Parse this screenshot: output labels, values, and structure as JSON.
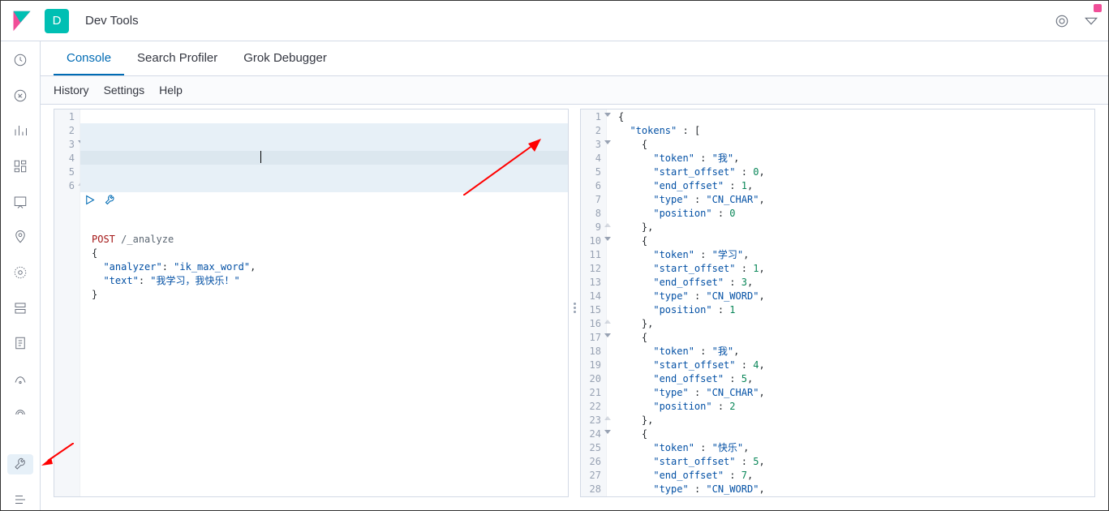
{
  "header": {
    "space_letter": "D",
    "breadcrumb": "Dev Tools"
  },
  "tabs": {
    "console": "Console",
    "profiler": "Search Profiler",
    "grok": "Grok Debugger"
  },
  "subbar": {
    "history": "History",
    "settings": "Settings",
    "help": "Help"
  },
  "request": {
    "lines": [
      "1",
      "2",
      "3",
      "4",
      "5",
      "6"
    ],
    "method": "POST",
    "url": "/_analyze",
    "body_open": "{",
    "analyzer_key": "\"analyzer\"",
    "analyzer_val": "\"ik_max_word\"",
    "text_key": "\"text\"",
    "text_val": "\"我学习，我快乐！\"",
    "body_close": "}"
  },
  "response": {
    "lines": [
      "1",
      "2",
      "3",
      "4",
      "5",
      "6",
      "7",
      "8",
      "9",
      "10",
      "11",
      "12",
      "13",
      "14",
      "15",
      "16",
      "17",
      "18",
      "19",
      "20",
      "21",
      "22",
      "23",
      "24",
      "25",
      "26",
      "27",
      "28"
    ],
    "rows": [
      {
        "indent": 0,
        "t": "punct",
        "v": "{"
      },
      {
        "indent": 1,
        "k": "\"tokens\"",
        "sep": " : ",
        "v": "[",
        "vt": "punct"
      },
      {
        "indent": 2,
        "t": "punct",
        "v": "{"
      },
      {
        "indent": 3,
        "k": "\"token\"",
        "sep": " : ",
        "v": "\"我\"",
        "vt": "str",
        "c": ","
      },
      {
        "indent": 3,
        "k": "\"start_offset\"",
        "sep": " : ",
        "v": "0",
        "vt": "num",
        "c": ","
      },
      {
        "indent": 3,
        "k": "\"end_offset\"",
        "sep": " : ",
        "v": "1",
        "vt": "num",
        "c": ","
      },
      {
        "indent": 3,
        "k": "\"type\"",
        "sep": " : ",
        "v": "\"CN_CHAR\"",
        "vt": "str",
        "c": ","
      },
      {
        "indent": 3,
        "k": "\"position\"",
        "sep": " : ",
        "v": "0",
        "vt": "num"
      },
      {
        "indent": 2,
        "t": "punct",
        "v": "},"
      },
      {
        "indent": 2,
        "t": "punct",
        "v": "{"
      },
      {
        "indent": 3,
        "k": "\"token\"",
        "sep": " : ",
        "v": "\"学习\"",
        "vt": "str",
        "c": ","
      },
      {
        "indent": 3,
        "k": "\"start_offset\"",
        "sep": " : ",
        "v": "1",
        "vt": "num",
        "c": ","
      },
      {
        "indent": 3,
        "k": "\"end_offset\"",
        "sep": " : ",
        "v": "3",
        "vt": "num",
        "c": ","
      },
      {
        "indent": 3,
        "k": "\"type\"",
        "sep": " : ",
        "v": "\"CN_WORD\"",
        "vt": "str",
        "c": ","
      },
      {
        "indent": 3,
        "k": "\"position\"",
        "sep": " : ",
        "v": "1",
        "vt": "num"
      },
      {
        "indent": 2,
        "t": "punct",
        "v": "},"
      },
      {
        "indent": 2,
        "t": "punct",
        "v": "{"
      },
      {
        "indent": 3,
        "k": "\"token\"",
        "sep": " : ",
        "v": "\"我\"",
        "vt": "str",
        "c": ","
      },
      {
        "indent": 3,
        "k": "\"start_offset\"",
        "sep": " : ",
        "v": "4",
        "vt": "num",
        "c": ","
      },
      {
        "indent": 3,
        "k": "\"end_offset\"",
        "sep": " : ",
        "v": "5",
        "vt": "num",
        "c": ","
      },
      {
        "indent": 3,
        "k": "\"type\"",
        "sep": " : ",
        "v": "\"CN_CHAR\"",
        "vt": "str",
        "c": ","
      },
      {
        "indent": 3,
        "k": "\"position\"",
        "sep": " : ",
        "v": "2",
        "vt": "num"
      },
      {
        "indent": 2,
        "t": "punct",
        "v": "},"
      },
      {
        "indent": 2,
        "t": "punct",
        "v": "{"
      },
      {
        "indent": 3,
        "k": "\"token\"",
        "sep": " : ",
        "v": "\"快乐\"",
        "vt": "str",
        "c": ","
      },
      {
        "indent": 3,
        "k": "\"start_offset\"",
        "sep": " : ",
        "v": "5",
        "vt": "num",
        "c": ","
      },
      {
        "indent": 3,
        "k": "\"end_offset\"",
        "sep": " : ",
        "v": "7",
        "vt": "num",
        "c": ","
      },
      {
        "indent": 3,
        "k": "\"type\"",
        "sep": " : ",
        "v": "\"CN_WORD\"",
        "vt": "str",
        "c": ","
      }
    ]
  },
  "sideNav": [
    "recent",
    "discover",
    "visualize",
    "dashboard",
    "canvas",
    "maps",
    "ml",
    "graph",
    "logs",
    "metrics",
    "apm",
    "siem"
  ]
}
